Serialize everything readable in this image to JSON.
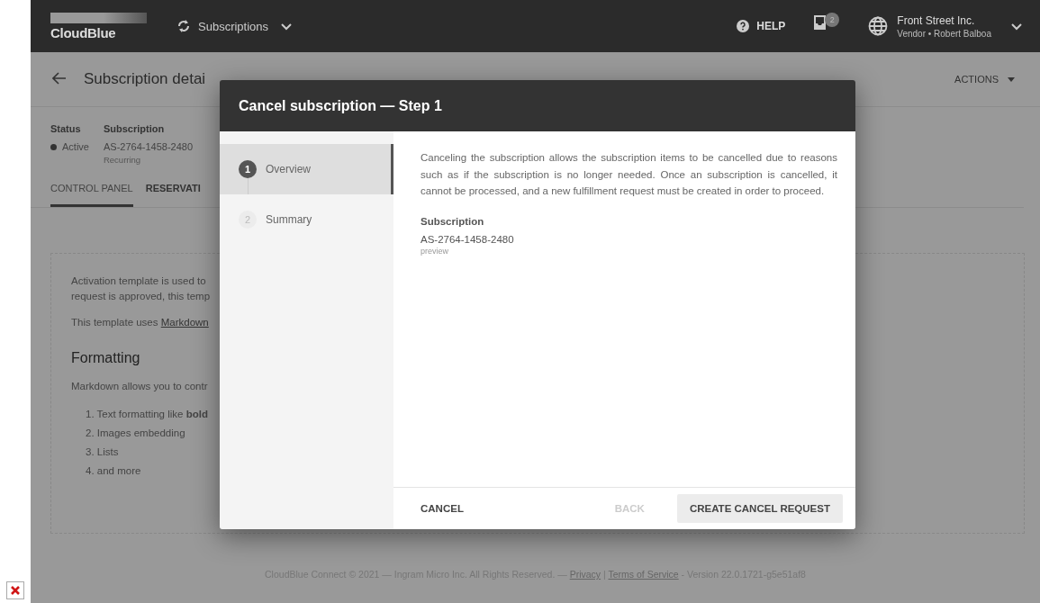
{
  "header": {
    "logo": "CloudBlue",
    "nav": "Subscriptions",
    "help": "HELP",
    "notifications": "2",
    "account": {
      "name": "Front Street Inc.",
      "role": "Vendor • Robert Balboa"
    }
  },
  "page": {
    "title": "Subscription detai",
    "actions": "ACTIONS",
    "fields": [
      {
        "label": "Status",
        "value": "Active",
        "kind": "status"
      },
      {
        "label": "Subscription",
        "value": "AS-2764-1458-2480",
        "note": "Recurring",
        "kind": "text"
      }
    ],
    "tabs": [
      {
        "label": "CONTROL PANEL",
        "selected": true
      },
      {
        "label": "RESERVATI",
        "selected": false
      }
    ],
    "card": {
      "intro": [
        "Activation template is used to",
        "request is approved, this temp"
      ],
      "markdown_line": {
        "prefix": "This template uses ",
        "link": "Markdown"
      },
      "heading": "Formatting",
      "lead": "Markdown allows you to contr",
      "list": [
        "1. Text formatting like **bold**",
        "2. Images embedding",
        "3. Lists",
        "4. and more"
      ]
    }
  },
  "modal": {
    "title": "Cancel subscription — Step 1",
    "steps": [
      {
        "number": "1",
        "label": "Overview",
        "selected": true
      },
      {
        "number": "2",
        "label": "Summary",
        "selected": false
      }
    ],
    "description": "Canceling the subscription allows the subscription items to be cancelled due to reasons such as if the subscription is no longer needed. Once an subscription is cancelled, it cannot be processed, and a new fulfillment request must be created in order to proceed.",
    "field": {
      "label": "Subscription",
      "value": "AS-2764-1458-2480",
      "note": "preview"
    },
    "buttons": [
      {
        "label": "CANCEL",
        "kind": "text",
        "disabled": false
      },
      {
        "label": "BACK",
        "kind": "text",
        "disabled": true
      },
      {
        "label": "CREATE CANCEL REQUEST",
        "kind": "filled",
        "disabled": false
      }
    ]
  },
  "footer": {
    "prefix": "CloudBlue Connect © 2021 — Ingram Micro Inc. All Rights Reserved. — ",
    "links": [
      "Privacy",
      "Terms of Service"
    ],
    "separator": " | ",
    "suffix": " - Version 22.0.1721-g5e51af8"
  }
}
